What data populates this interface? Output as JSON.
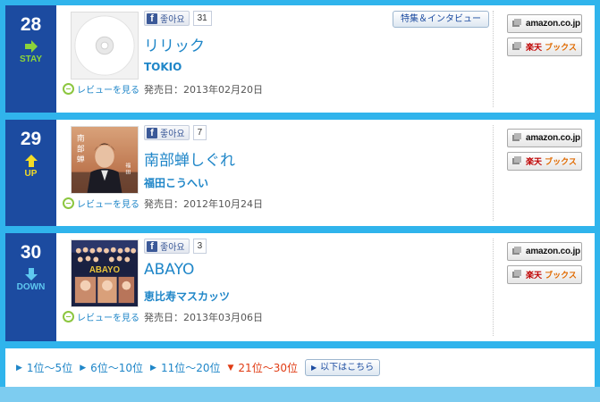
{
  "colors": {
    "page_bg": "#30b4ec",
    "rank_bg": "#1c4ba0",
    "link_blue": "#1f86c8",
    "stay_green": "#8cd43a",
    "up_yellow": "#f4dc26",
    "down_cyan": "#5ec8f0",
    "current_red": "#e03c14",
    "rakuten_red": "#bf0000"
  },
  "entries": [
    {
      "rank": "28",
      "movement": "STAY",
      "movement_icon": "right-arrow-icon",
      "cover_icon": "cd-disc-placeholder",
      "fb_like_label": "좋아요",
      "fb_count": "31",
      "feature_label": "特集＆インタビュー",
      "title": "リリック",
      "artist": "TOKIO",
      "review_label": "レビューを見る",
      "release_label": "発売日：",
      "release_date": "2013年02月20日",
      "amazon_label": "amazon.co.jp",
      "rakuten_label": "楽天",
      "rakuten_books_label": "ブックス"
    },
    {
      "rank": "29",
      "movement": "UP",
      "movement_icon": "up-arrow-icon",
      "cover_icon": "album-cover-photo",
      "fb_like_label": "좋아요",
      "fb_count": "7",
      "title": "南部蝉しぐれ",
      "artist": "福田こうへい",
      "review_label": "レビューを見る",
      "release_label": "発売日：",
      "release_date": "2012年10月24日",
      "amazon_label": "amazon.co.jp",
      "rakuten_label": "楽天",
      "rakuten_books_label": "ブックス"
    },
    {
      "rank": "30",
      "movement": "DOWN",
      "movement_icon": "down-arrow-icon",
      "cover_icon": "album-cover-photo",
      "fb_like_label": "좋아요",
      "fb_count": "3",
      "title": "ABAYO",
      "artist": "恵比寿マスカッツ",
      "review_label": "レビューを見る",
      "release_label": "発売日：",
      "release_date": "2013年03月06日",
      "amazon_label": "amazon.co.jp",
      "rakuten_label": "楽天",
      "rakuten_books_label": "ブックス"
    }
  ],
  "pager": {
    "items": [
      "1位〜5位",
      "6位〜10位",
      "11位〜20位",
      "21位〜30位"
    ],
    "current": "21位〜30位",
    "more_label": "以下はこちら"
  }
}
